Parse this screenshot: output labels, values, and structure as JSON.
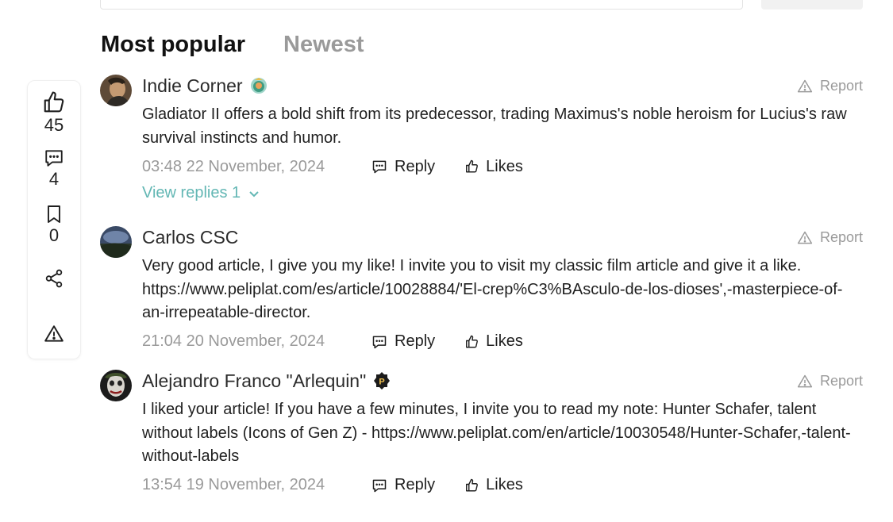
{
  "tabs": [
    {
      "label": "Most popular",
      "active": true
    },
    {
      "label": "Newest",
      "active": false
    }
  ],
  "sidebar": {
    "likes_count": "45",
    "comments_count": "4",
    "saves_count": "0"
  },
  "actions": {
    "reply_label": "Reply",
    "likes_label": "Likes",
    "report_label": "Report"
  },
  "comments": [
    {
      "author": "Indie Corner",
      "badge": "green-badge-icon",
      "text": "Gladiator II offers a bold shift from its predecessor, trading Maximus's noble heroism for Lucius's raw survival instincts and humor.",
      "date": "03:48 22 November, 2024",
      "view_replies": "View replies 1"
    },
    {
      "author": "Carlos CSC",
      "text": "Very good article, I give you my like! I invite you to visit my classic film article and give it a like. https://www.peliplat.com/es/article/10028884/'El-crep%C3%BAsculo-de-los-dioses',-masterpiece-of-an-irrepeatable-director.",
      "date": "21:04 20 November, 2024"
    },
    {
      "author": "Alejandro Franco \"Arlequin\"",
      "badge": "premium-badge-icon",
      "text": "I liked your article!  If you have a few minutes, I invite you to read my note: Hunter Schafer, talent without labels (Icons of Gen Z) -  https://www.peliplat.com/en/article/10030548/Hunter-Schafer,-talent-without-labels",
      "date": "13:54 19 November, 2024"
    }
  ],
  "colors": {
    "accent_teal": "#63b7b4",
    "muted_text": "#9a9a9a",
    "primary_text": "#1f1f1f"
  }
}
